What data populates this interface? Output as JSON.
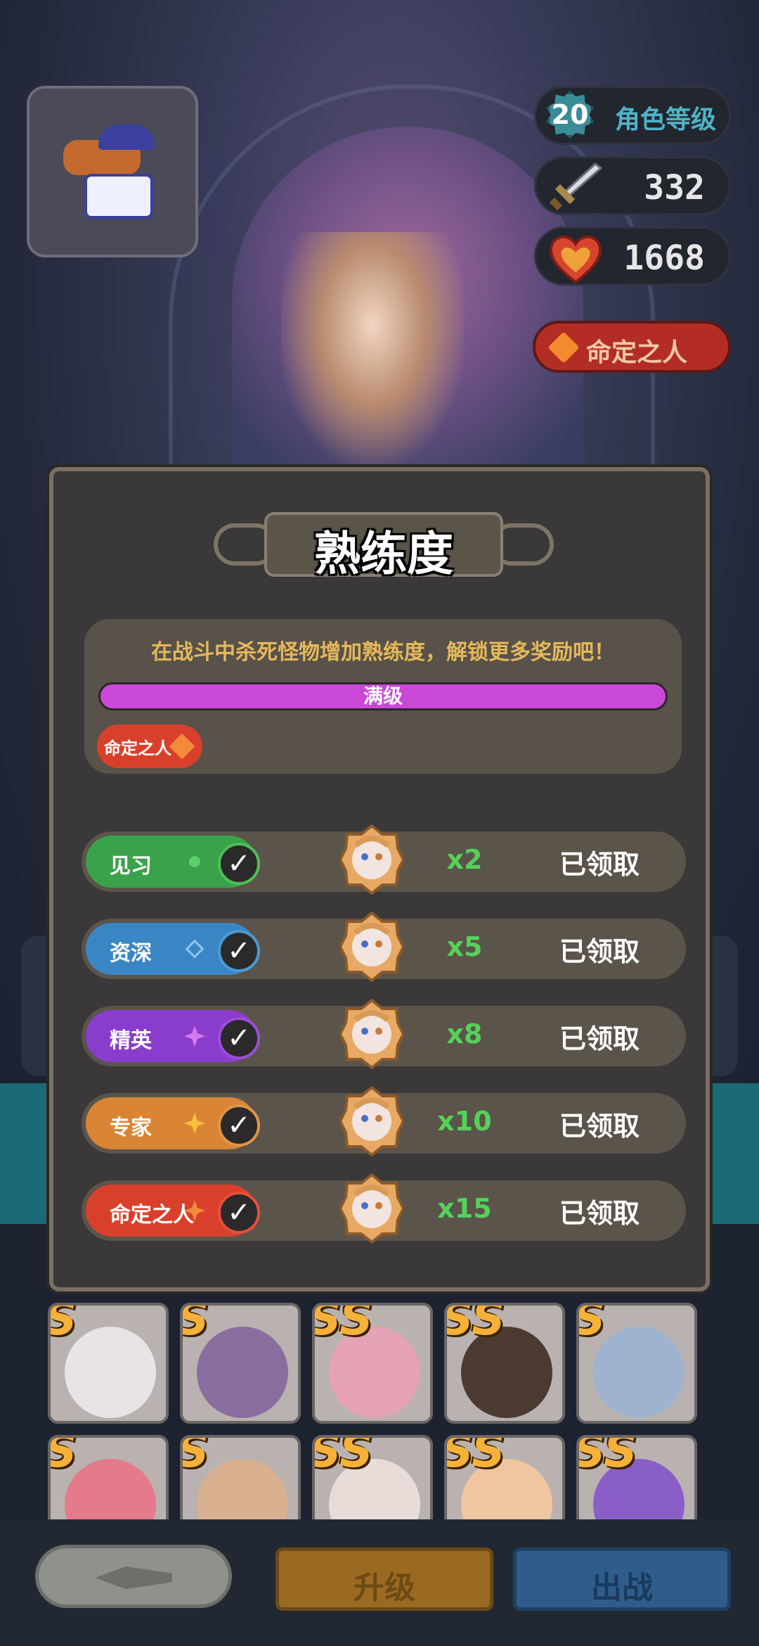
{
  "header": {
    "level": "20",
    "level_label": "角色等级",
    "attack": "332",
    "hp": "1668",
    "fate_label": "命定之人"
  },
  "dialog": {
    "title": "熟练度",
    "info_text": "在战斗中杀死怪物增加熟练度，解锁更多奖励吧！",
    "progress_label": "满级",
    "progress_fraction": 1.0,
    "current_tier": "命定之人"
  },
  "tiers": [
    {
      "label": "见习",
      "qty": "x2",
      "status": "已领取",
      "color": "#3aa24a",
      "check_color": "#4fbf55",
      "mark": "dot-icon"
    },
    {
      "label": "资深",
      "qty": "x5",
      "status": "已领取",
      "color": "#3a86c4",
      "check_color": "#4a9ad6",
      "mark": "diamond-icon"
    },
    {
      "label": "精英",
      "qty": "x8",
      "status": "已领取",
      "color": "#8a3ccc",
      "check_color": "#9b4ed9",
      "mark": "sparkle-icon"
    },
    {
      "label": "专家",
      "qty": "x10",
      "status": "已领取",
      "color": "#d98535",
      "check_color": "#e09444",
      "mark": "star-icon"
    },
    {
      "label": "命定之人",
      "qty": "x15",
      "status": "已领取",
      "color": "#d9402c",
      "check_color": "#e5503a",
      "mark": "gem-icon"
    }
  ],
  "roster": {
    "row1": [
      "S",
      "S",
      "SS",
      "SS",
      "S"
    ],
    "row2": [
      "S",
      "S",
      "SS",
      "SS",
      "SS"
    ]
  },
  "buttons": {
    "upgrade": "升级",
    "deploy": "出战"
  },
  "colors": {
    "qty_green": "#55d15a",
    "progress_fill": "#c948d8",
    "info_gold": "#e5b85a"
  }
}
